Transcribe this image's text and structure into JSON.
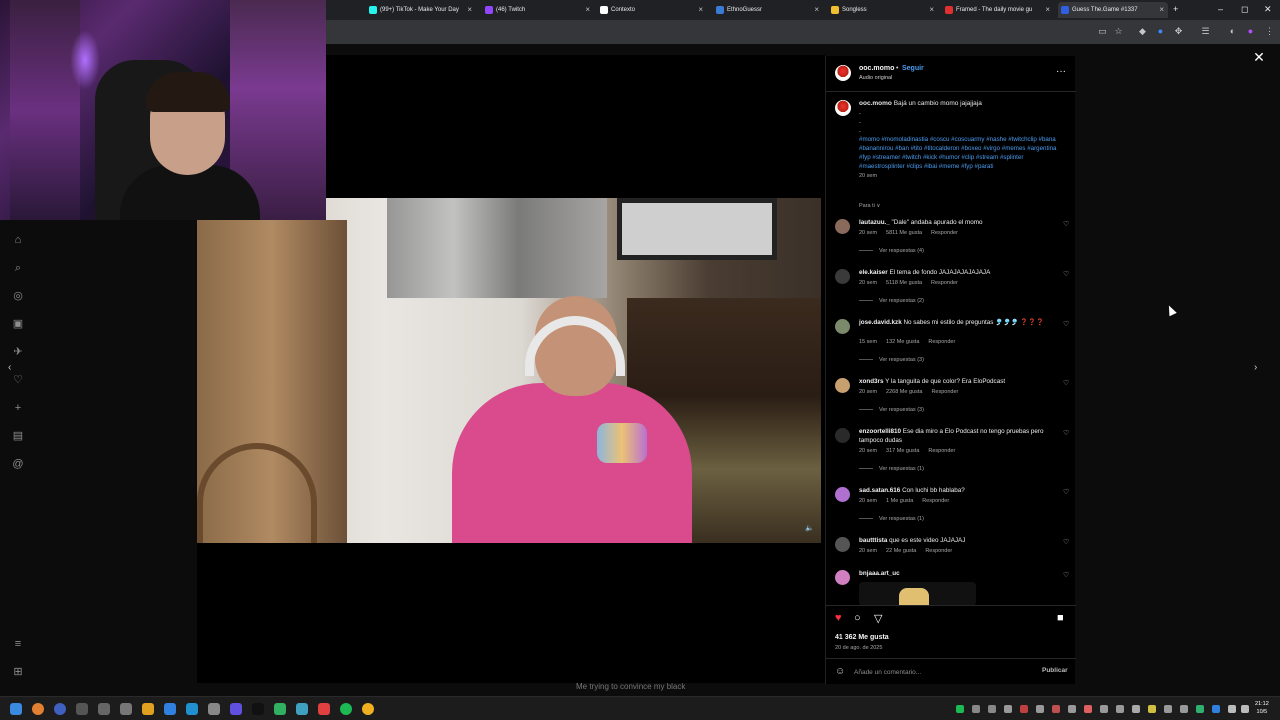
{
  "browser": {
    "tabs": [
      {
        "label": "(99+) TikTok - Make Your Day",
        "color": "#25f4ee"
      },
      {
        "label": "(46) Twitch",
        "color": "#9146ff"
      },
      {
        "label": "Contexto",
        "color": "#ffffff"
      },
      {
        "label": "EthnoGuessr",
        "color": "#3a7bd5"
      },
      {
        "label": "Songless",
        "color": "#f0c030"
      },
      {
        "label": "Framed - The daily movie gu",
        "color": "#e03030"
      },
      {
        "label": "Guess The.Game #1337",
        "color": "#3060e0"
      }
    ],
    "new_tab": "+",
    "tab_close": "×",
    "controls": {
      "minimize": "–",
      "maximize": "◻",
      "close": "✕"
    }
  },
  "post": {
    "username": "ooc.momo",
    "dot": "•",
    "follow": "Seguir",
    "audio": "Audio original",
    "more": "···",
    "caption_text": "Bajá un cambio momo jajajjaja",
    "caption_dots": [
      ".",
      ".",
      "."
    ],
    "hashtags": "#momo #momoladinastia #coscu #coscuarmy #nashe #twitchclip #bana #banannirou #ban #tito #titocalderon #boxeo #virgo #memes #argentina #fyp #streamer #twitch #kick #humor #clip #stream #splinter #maestrosplinter #clips #ibai #meme #fyp #parati",
    "caption_age": "20 sem",
    "sort": "Para ti ∨",
    "likes": "41 362 Me gusta",
    "date": "20 de ago. de 2025",
    "comment_placeholder": "Añade un comentario...",
    "publish": "Publicar"
  },
  "comments": [
    {
      "user": "lautazuu._",
      "text": "\"Dale\" andaba apurado el momo",
      "age": "20 sem",
      "likes": "5811 Me gusta",
      "reply": "Responder",
      "replies": "Ver respuestas (4)"
    },
    {
      "user": "ele.kaiser",
      "text": "El tema de fondo JAJAJAJAJAJAJA",
      "age": "20 sem",
      "likes": "5118 Me gusta",
      "reply": "Responder",
      "replies": "Ver respuestas (2)"
    },
    {
      "user": "jose.david.kzk",
      "text": "No sabes mi estilo de preguntas 🎐🎐🎐 ❓❓❓",
      "age": "15 sem",
      "likes": "132 Me gusta",
      "reply": "Responder",
      "replies": "Ver respuestas (3)"
    },
    {
      "user": "xond3rs",
      "text": "Y la tanguita de que color? Era EloPodcast",
      "age": "20 sem",
      "likes": "2268 Me gusta",
      "reply": "Responder",
      "replies": "Ver respuestas (3)"
    },
    {
      "user": "enzoortelli810",
      "text": "Ese dia miro a Elo Podcast no tengo pruebas pero tampoco dudas",
      "age": "20 sem",
      "likes": "317 Me gusta",
      "reply": "Responder",
      "replies": "Ver respuestas (1)"
    },
    {
      "user": "sad.satan.616",
      "text": "Con luchi bb hablaba?",
      "age": "20 sem",
      "likes": "1 Me gusta",
      "reply": "Responder",
      "replies": "Ver respuestas (1)"
    },
    {
      "user": "bautttista",
      "text": "que es este video JAJAJAJ",
      "age": "20 sem",
      "likes": "22 Me gusta",
      "reply": "Responder",
      "replies": ""
    },
    {
      "user": "bnjaaa.art_uc",
      "text": "",
      "age": "",
      "likes": "",
      "reply": "",
      "replies": ""
    }
  ],
  "video_caption": "Me trying to convince my black",
  "icons": {
    "heart": "♥",
    "close": "✕",
    "prev": "‹",
    "next": "›"
  },
  "taskbar": {
    "time": "21:12",
    "date": "10/5"
  }
}
